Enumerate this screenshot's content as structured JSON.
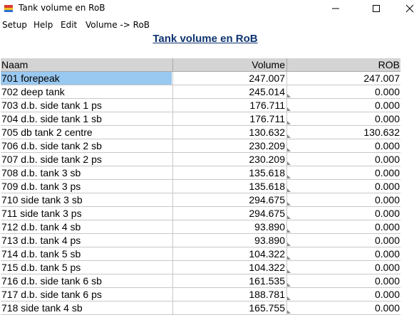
{
  "window": {
    "title": "Tank volume en RoB",
    "icon": "tank-app-icon",
    "controls": [
      "minimize-icon",
      "maximize-icon",
      "close-icon"
    ]
  },
  "menu": {
    "items": [
      "Setup",
      "Help",
      "Edit",
      "Volume -> RoB"
    ]
  },
  "heading": "Tank volume en RoB",
  "table": {
    "columns": [
      "Naam",
      "Volume",
      "ROB"
    ],
    "rows": [
      {
        "name": "701 forepeak",
        "volume": "247.007",
        "rob": "247.007"
      },
      {
        "name": "702 deep tank",
        "volume": "245.014",
        "rob": "0.000"
      },
      {
        "name": "703 d.b. side tank 1 ps",
        "volume": "176.711",
        "rob": "0.000"
      },
      {
        "name": "704 d.b. side tank 1 sb",
        "volume": "176.711",
        "rob": "0.000"
      },
      {
        "name": "705 db tank 2 centre",
        "volume": "130.632",
        "rob": "130.632"
      },
      {
        "name": "706 d.b. side tank 2 sb",
        "volume": "230.209",
        "rob": "0.000"
      },
      {
        "name": "707 d.b. side tank 2 ps",
        "volume": "230.209",
        "rob": "0.000"
      },
      {
        "name": "708 d.b. tank 3 sb",
        "volume": "135.618",
        "rob": "0.000"
      },
      {
        "name": "709 d.b. tank 3 ps",
        "volume": "135.618",
        "rob": "0.000"
      },
      {
        "name": "710 side tank 3 sb",
        "volume": "294.675",
        "rob": "0.000"
      },
      {
        "name": "711 side tank 3 ps",
        "volume": "294.675",
        "rob": "0.000"
      },
      {
        "name": "712 d.b. tank 4 sb",
        "volume": "93.890",
        "rob": "0.000"
      },
      {
        "name": "713 d.b. tank 4 ps",
        "volume": "93.890",
        "rob": "0.000"
      },
      {
        "name": "714 d.b. tank 5 sb",
        "volume": "104.322",
        "rob": "0.000"
      },
      {
        "name": "715 d.b. tank 5 ps",
        "volume": "104.322",
        "rob": "0.000"
      },
      {
        "name": "716 d.b. side tank 6 sb",
        "volume": "161.535",
        "rob": "0.000"
      },
      {
        "name": "717 d.b. side tank 6 ps",
        "volume": "188.781",
        "rob": "0.000"
      },
      {
        "name": "718 side tank 4 sb",
        "volume": "165.755",
        "rob": "0.000"
      }
    ],
    "selected_row": "701 forepeak"
  },
  "colors": {
    "selection": "#99c8f0",
    "header_bg": "#d4d4d4",
    "heading": "#0f3470",
    "grid": "#c8c8c8"
  }
}
